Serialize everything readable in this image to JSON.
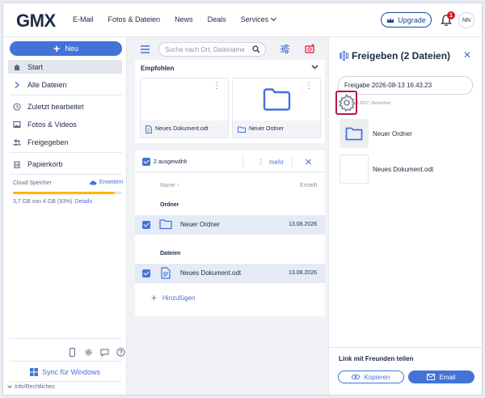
{
  "header": {
    "logo": "GMX",
    "nav": [
      "E-Mail",
      "Fotos & Dateien",
      "News",
      "Deals"
    ],
    "services": "Services",
    "upgrade_label": "Upgrade",
    "notification_count": "1",
    "avatar_initials": "NN"
  },
  "sidebar": {
    "new_label": "Neu",
    "items": [
      {
        "label": "Start",
        "icon": "home-icon"
      },
      {
        "label": "Alle Dateien",
        "icon": "chevron-right-icon"
      },
      {
        "label": "Zuletzt bearbeitet",
        "icon": "clock-icon"
      },
      {
        "label": "Fotos & Videos",
        "icon": "image-icon"
      },
      {
        "label": "Freigegeben",
        "icon": "users-icon"
      },
      {
        "label": "Papierkorb",
        "icon": "trash-icon"
      }
    ],
    "storage": {
      "label": "Cloud Speicher",
      "expand": "Erweitern",
      "used_fraction": 0.93,
      "text": "3,7 GB von 4 GB (93%)",
      "details": "Details"
    },
    "sync_label": "Sync für Windows",
    "info_label": "Info/Rechtliches"
  },
  "toolbar": {
    "search_placeholder": "Suche nach Ort, Dateiname"
  },
  "recommended": {
    "title": "Empfohlen",
    "tiles": [
      {
        "name": "Neues Dokument.odt",
        "type": "document"
      },
      {
        "name": "Neuer Ordner",
        "type": "folder"
      }
    ]
  },
  "selection": {
    "count_label": "2 ausgewählt",
    "more_label": "mehr",
    "col_name": "Name",
    "col_created": "Erstellt",
    "group_folders": "Ordner",
    "group_files": "Dateien",
    "rows": [
      {
        "name": "Neuer Ordner",
        "date": "13.08.2026",
        "type": "folder"
      },
      {
        "name": "Neues Dokument.odt",
        "date": "13.08.2026",
        "type": "document"
      }
    ],
    "add_label": "Hinzufügen"
  },
  "panel": {
    "title": "Freigeben (2 Dateien)",
    "share_name": "Freigabe 2026-08-13 16.43.23",
    "share_meta": "13.08.2027 | Betrachter",
    "items": [
      {
        "name": "Neuer Ordner",
        "type": "folder"
      },
      {
        "name": "Neues Dokument.odt",
        "type": "document"
      }
    ],
    "link_title": "Link mit Freunden teilen",
    "copy_label": "Kopieren",
    "email_label": "Email"
  },
  "colors": {
    "accent": "#4473d7",
    "brand_dark": "#1c449b",
    "storage_bar": "#ffb700",
    "highlight_box": "#b5174a",
    "badge": "#d3192d"
  }
}
